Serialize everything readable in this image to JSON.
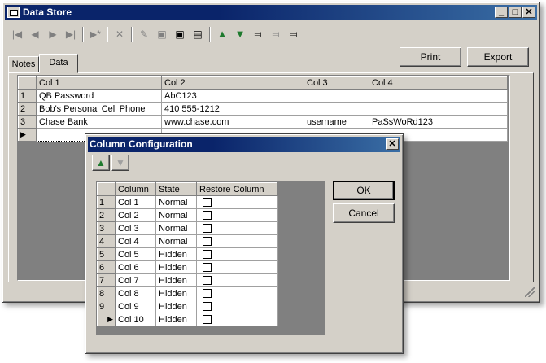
{
  "main_window": {
    "title": "Data Store",
    "controls": [
      "_",
      "□",
      "✕"
    ],
    "tabs": [
      "Notes",
      "Data"
    ],
    "active_tab": "Data",
    "print_label": "Print",
    "export_label": "Export",
    "table": {
      "columns": [
        "Col 1",
        "Col 2",
        "Col 3",
        "Col 4"
      ],
      "rows": [
        {
          "num": "1",
          "cells": [
            "QB Password",
            "AbC123",
            "",
            ""
          ]
        },
        {
          "num": "2",
          "cells": [
            "Bob's Personal Cell Phone",
            "410 555-1212",
            "",
            ""
          ]
        },
        {
          "num": "3",
          "cells": [
            "Chase Bank",
            "www.chase.com",
            "username",
            "PaSsWoRd123"
          ]
        }
      ],
      "new_row_marker": "▶"
    }
  },
  "dialog": {
    "title": "Column Configuration",
    "close": "✕",
    "ok_label": "OK",
    "cancel_label": "Cancel",
    "table": {
      "columns": [
        "Column",
        "State",
        "Restore Column"
      ],
      "rows": [
        {
          "num": "1",
          "column": "Col 1",
          "state": "Normal"
        },
        {
          "num": "2",
          "column": "Col 2",
          "state": "Normal"
        },
        {
          "num": "3",
          "column": "Col 3",
          "state": "Normal"
        },
        {
          "num": "4",
          "column": "Col 4",
          "state": "Normal"
        },
        {
          "num": "5",
          "column": "Col 5",
          "state": "Hidden"
        },
        {
          "num": "6",
          "column": "Col 6",
          "state": "Hidden"
        },
        {
          "num": "7",
          "column": "Col 7",
          "state": "Hidden"
        },
        {
          "num": "8",
          "column": "Col 8",
          "state": "Hidden"
        },
        {
          "num": "9",
          "column": "Col 9",
          "state": "Hidden"
        },
        {
          "num": "",
          "column": "Col 10",
          "state": "Hidden",
          "marker": "▶"
        }
      ]
    }
  }
}
